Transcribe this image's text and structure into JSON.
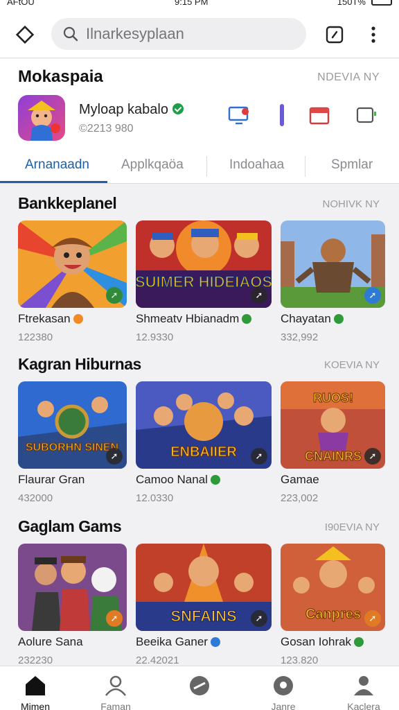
{
  "status_bar": {
    "carrier": "AFtOU",
    "time": "9:15 PM",
    "battery": "150T%"
  },
  "search": {
    "placeholder": "Ilnarkesyplaan"
  },
  "header": {
    "title": "Mokaspaia",
    "more": "NDEVIA NY",
    "app_name": "Myloap kabalo",
    "app_count": "©2213 980"
  },
  "tabs": [
    {
      "label": "Arnanaadn",
      "active": true
    },
    {
      "label": "Applkqaöa"
    },
    {
      "label": "Indoahaa"
    },
    {
      "label": "Spmlar"
    }
  ],
  "sections": [
    {
      "title": "Bankkeplanel",
      "more": "NOHIVK NY",
      "cards": [
        {
          "name": "Ftrekasan",
          "sub": "122380"
        },
        {
          "name": "Shmeatv Hbianadm",
          "sub": "12.9330",
          "thumb_text": "SUIMER HIDEIAOS"
        },
        {
          "name": "Chayatan",
          "sub": "332,992"
        }
      ]
    },
    {
      "title": "Kagran Hiburnas",
      "more": "KOEVIA NY",
      "cards": [
        {
          "name": "Flaurar Gran",
          "sub": "432000",
          "thumb_text": "SUBORHN SINEN"
        },
        {
          "name": "Camoo Nanal",
          "sub": "12.0330",
          "thumb_text": "ENBAIIER"
        },
        {
          "name": "Gamae",
          "sub": "223,002",
          "thumb_text": "CNAINRS"
        }
      ]
    },
    {
      "title": "Gaglam Gams",
      "more": "I90EVIA NY",
      "cards": [
        {
          "name": "Aolure Sana",
          "sub": "232230"
        },
        {
          "name": "Beeika Ganer",
          "sub": "22.42021",
          "thumb_text": "SNFAINS"
        },
        {
          "name": "Gosan Iohrak",
          "sub": "123.820",
          "thumb_text": "Canpres"
        }
      ]
    }
  ],
  "bottom_nav": [
    {
      "label": "Mimen",
      "icon": "home-icon",
      "active": true
    },
    {
      "label": "Faman",
      "icon": "person-group-icon"
    },
    {
      "label": "",
      "icon": "compass-icon"
    },
    {
      "label": "Janre",
      "icon": "badge-icon"
    },
    {
      "label": "Kaclera",
      "icon": "profile-icon"
    }
  ],
  "colors": {
    "accent": "#1c5fa8",
    "verified": "#1e9e4a",
    "background": "#f1f1f3"
  }
}
